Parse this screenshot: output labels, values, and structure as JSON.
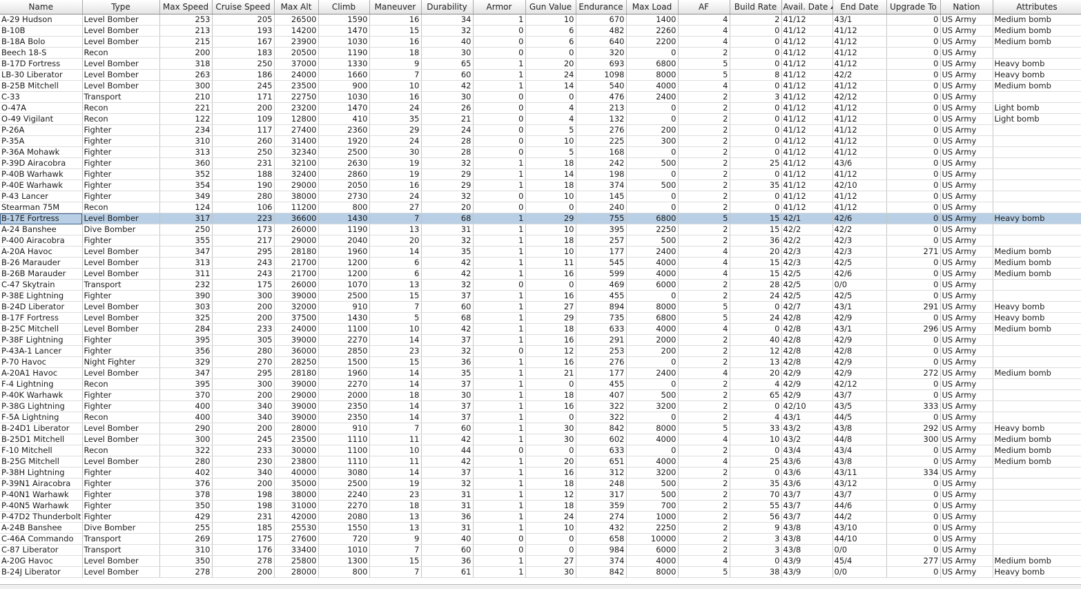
{
  "columns": [
    {
      "key": "name",
      "label": "Name",
      "align": "txt"
    },
    {
      "key": "type",
      "label": "Type",
      "align": "txt"
    },
    {
      "key": "max_speed",
      "label": "Max Speed",
      "align": "num"
    },
    {
      "key": "cruise_speed",
      "label": "Cruise Speed",
      "align": "num"
    },
    {
      "key": "max_alt",
      "label": "Max Alt",
      "align": "num"
    },
    {
      "key": "climb",
      "label": "Climb",
      "align": "num"
    },
    {
      "key": "maneuver",
      "label": "Maneuver",
      "align": "num"
    },
    {
      "key": "durability",
      "label": "Durability",
      "align": "num"
    },
    {
      "key": "armor",
      "label": "Armor",
      "align": "num"
    },
    {
      "key": "gun_value",
      "label": "Gun Value",
      "align": "num"
    },
    {
      "key": "endurance",
      "label": "Endurance",
      "align": "num"
    },
    {
      "key": "max_load",
      "label": "Max Load",
      "align": "num"
    },
    {
      "key": "af",
      "label": "AF",
      "align": "num"
    },
    {
      "key": "build_rate",
      "label": "Build Rate",
      "align": "num"
    },
    {
      "key": "avail_date",
      "label": "Avail. Date",
      "align": "txt",
      "sorted": "asc"
    },
    {
      "key": "end_date",
      "label": "End Date",
      "align": "txt"
    },
    {
      "key": "upgrade_to",
      "label": "Upgrade To",
      "align": "num"
    },
    {
      "key": "nation",
      "label": "Nation",
      "align": "txt"
    },
    {
      "key": "attributes",
      "label": "Attributes",
      "align": "txt"
    }
  ],
  "selected_row": 18,
  "rows": [
    [
      "A-29 Hudson",
      "Level Bomber",
      "253",
      "205",
      "26500",
      "1590",
      "16",
      "34",
      "1",
      "10",
      "670",
      "1400",
      "4",
      "2",
      "41/12",
      "43/1",
      "0",
      "US Army",
      "Medium bomb"
    ],
    [
      "B-10B",
      "Level Bomber",
      "213",
      "193",
      "14200",
      "1470",
      "15",
      "32",
      "0",
      "6",
      "482",
      "2260",
      "4",
      "0",
      "41/12",
      "41/12",
      "0",
      "US Army",
      "Medium bomb"
    ],
    [
      "B-18A Bolo",
      "Level Bomber",
      "215",
      "167",
      "23900",
      "1030",
      "16",
      "40",
      "0",
      "6",
      "640",
      "2200",
      "4",
      "0",
      "41/12",
      "41/12",
      "0",
      "US Army",
      "Medium bomb"
    ],
    [
      "Beech 18-S",
      "Recon",
      "200",
      "183",
      "20500",
      "1190",
      "18",
      "30",
      "0",
      "0",
      "320",
      "0",
      "2",
      "0",
      "41/12",
      "41/12",
      "0",
      "US Army",
      ""
    ],
    [
      "B-17D Fortress",
      "Level Bomber",
      "318",
      "250",
      "37000",
      "1330",
      "9",
      "65",
      "1",
      "20",
      "693",
      "6800",
      "5",
      "0",
      "41/12",
      "41/12",
      "0",
      "US Army",
      "Heavy bomb"
    ],
    [
      "LB-30 Liberator",
      "Level Bomber",
      "263",
      "186",
      "24000",
      "1660",
      "7",
      "60",
      "1",
      "24",
      "1098",
      "8000",
      "5",
      "8",
      "41/12",
      "42/2",
      "0",
      "US Army",
      "Heavy bomb"
    ],
    [
      "B-25B Mitchell",
      "Level Bomber",
      "300",
      "245",
      "23500",
      "900",
      "10",
      "42",
      "1",
      "14",
      "540",
      "4000",
      "4",
      "0",
      "41/12",
      "41/12",
      "0",
      "US Army",
      "Medium bomb"
    ],
    [
      "C-33",
      "Transport",
      "210",
      "171",
      "22750",
      "1030",
      "16",
      "30",
      "0",
      "0",
      "476",
      "2400",
      "2",
      "3",
      "41/12",
      "42/12",
      "0",
      "US Army",
      ""
    ],
    [
      "O-47A",
      "Recon",
      "221",
      "200",
      "23200",
      "1470",
      "24",
      "26",
      "0",
      "4",
      "213",
      "0",
      "2",
      "0",
      "41/12",
      "41/12",
      "0",
      "US Army",
      "Light bomb"
    ],
    [
      "O-49 Vigilant",
      "Recon",
      "122",
      "109",
      "12800",
      "410",
      "35",
      "21",
      "0",
      "4",
      "132",
      "0",
      "2",
      "0",
      "41/12",
      "41/12",
      "0",
      "US Army",
      "Light bomb"
    ],
    [
      "P-26A",
      "Fighter",
      "234",
      "117",
      "27400",
      "2360",
      "29",
      "24",
      "0",
      "5",
      "276",
      "200",
      "2",
      "0",
      "41/12",
      "41/12",
      "0",
      "US Army",
      ""
    ],
    [
      "P-35A",
      "Fighter",
      "310",
      "260",
      "31400",
      "1920",
      "24",
      "28",
      "0",
      "10",
      "225",
      "300",
      "2",
      "0",
      "41/12",
      "41/12",
      "0",
      "US Army",
      ""
    ],
    [
      "P-36A Mohawk",
      "Fighter",
      "313",
      "250",
      "32340",
      "2500",
      "30",
      "28",
      "0",
      "5",
      "168",
      "0",
      "2",
      "0",
      "41/12",
      "41/12",
      "0",
      "US Army",
      ""
    ],
    [
      "P-39D Airacobra",
      "Fighter",
      "360",
      "231",
      "32100",
      "2630",
      "19",
      "32",
      "1",
      "18",
      "242",
      "500",
      "2",
      "25",
      "41/12",
      "43/6",
      "0",
      "US Army",
      ""
    ],
    [
      "P-40B Warhawk",
      "Fighter",
      "352",
      "188",
      "32400",
      "2860",
      "19",
      "29",
      "1",
      "14",
      "198",
      "0",
      "2",
      "0",
      "41/12",
      "41/12",
      "0",
      "US Army",
      ""
    ],
    [
      "P-40E Warhawk",
      "Fighter",
      "354",
      "190",
      "29000",
      "2050",
      "16",
      "29",
      "1",
      "18",
      "374",
      "500",
      "2",
      "35",
      "41/12",
      "42/10",
      "0",
      "US Army",
      ""
    ],
    [
      "P-43 Lancer",
      "Fighter",
      "349",
      "280",
      "38000",
      "2730",
      "24",
      "32",
      "0",
      "10",
      "145",
      "0",
      "2",
      "0",
      "41/12",
      "41/12",
      "0",
      "US Army",
      ""
    ],
    [
      "Stearman 75M",
      "Recon",
      "124",
      "106",
      "11200",
      "800",
      "27",
      "20",
      "0",
      "0",
      "240",
      "0",
      "2",
      "0",
      "41/12",
      "41/12",
      "0",
      "US Army",
      ""
    ],
    [
      "B-17E Fortress",
      "Level Bomber",
      "317",
      "223",
      "36600",
      "1430",
      "7",
      "68",
      "1",
      "29",
      "755",
      "6800",
      "5",
      "15",
      "42/1",
      "42/6",
      "0",
      "US Army",
      "Heavy bomb"
    ],
    [
      "A-24 Banshee",
      "Dive Bomber",
      "250",
      "173",
      "26000",
      "1190",
      "13",
      "31",
      "1",
      "10",
      "395",
      "2250",
      "2",
      "15",
      "42/2",
      "42/2",
      "0",
      "US Army",
      ""
    ],
    [
      "P-400 Airacobra",
      "Fighter",
      "355",
      "217",
      "29000",
      "2040",
      "20",
      "32",
      "1",
      "18",
      "257",
      "500",
      "2",
      "36",
      "42/2",
      "42/3",
      "0",
      "US Army",
      ""
    ],
    [
      "A-20A Havoc",
      "Level Bomber",
      "347",
      "295",
      "28180",
      "1960",
      "14",
      "35",
      "1",
      "10",
      "177",
      "2400",
      "4",
      "20",
      "42/3",
      "42/3",
      "271",
      "US Army",
      "Medium bomb"
    ],
    [
      "B-26 Marauder",
      "Level Bomber",
      "313",
      "243",
      "21700",
      "1200",
      "6",
      "42",
      "1",
      "11",
      "545",
      "4000",
      "4",
      "15",
      "42/3",
      "42/5",
      "0",
      "US Army",
      "Medium bomb"
    ],
    [
      "B-26B Marauder",
      "Level Bomber",
      "311",
      "243",
      "21700",
      "1200",
      "6",
      "42",
      "1",
      "16",
      "599",
      "4000",
      "4",
      "15",
      "42/5",
      "42/6",
      "0",
      "US Army",
      "Medium bomb"
    ],
    [
      "C-47 Skytrain",
      "Transport",
      "232",
      "175",
      "26000",
      "1070",
      "13",
      "32",
      "0",
      "0",
      "469",
      "6000",
      "2",
      "28",
      "42/5",
      "0/0",
      "0",
      "US Army",
      ""
    ],
    [
      "P-38E Lightning",
      "Fighter",
      "390",
      "300",
      "39000",
      "2500",
      "15",
      "37",
      "1",
      "16",
      "455",
      "0",
      "2",
      "24",
      "42/5",
      "42/5",
      "0",
      "US Army",
      ""
    ],
    [
      "B-24D Liberator",
      "Level Bomber",
      "303",
      "200",
      "32000",
      "910",
      "7",
      "60",
      "1",
      "27",
      "894",
      "8000",
      "5",
      "0",
      "42/7",
      "43/1",
      "291",
      "US Army",
      "Heavy bomb"
    ],
    [
      "B-17F Fortress",
      "Level Bomber",
      "325",
      "200",
      "37500",
      "1430",
      "5",
      "68",
      "1",
      "29",
      "735",
      "6800",
      "5",
      "24",
      "42/8",
      "42/9",
      "0",
      "US Army",
      "Heavy bomb"
    ],
    [
      "B-25C Mitchell",
      "Level Bomber",
      "284",
      "233",
      "24000",
      "1100",
      "10",
      "42",
      "1",
      "18",
      "633",
      "4000",
      "4",
      "0",
      "42/8",
      "43/1",
      "296",
      "US Army",
      "Medium bomb"
    ],
    [
      "P-38F Lightning",
      "Fighter",
      "395",
      "305",
      "39000",
      "2270",
      "14",
      "37",
      "1",
      "16",
      "291",
      "2000",
      "2",
      "40",
      "42/8",
      "42/9",
      "0",
      "US Army",
      ""
    ],
    [
      "P-43A-1 Lancer",
      "Fighter",
      "356",
      "280",
      "36000",
      "2850",
      "23",
      "32",
      "0",
      "12",
      "253",
      "200",
      "2",
      "12",
      "42/8",
      "42/8",
      "0",
      "US Army",
      ""
    ],
    [
      "P-70 Havoc",
      "Night Fighter",
      "329",
      "270",
      "28250",
      "1500",
      "15",
      "36",
      "1",
      "16",
      "276",
      "0",
      "2",
      "13",
      "42/8",
      "42/9",
      "0",
      "US Army",
      ""
    ],
    [
      "A-20A1 Havoc",
      "Level Bomber",
      "347",
      "295",
      "28180",
      "1960",
      "14",
      "35",
      "1",
      "21",
      "177",
      "2400",
      "4",
      "20",
      "42/9",
      "42/9",
      "272",
      "US Army",
      "Medium bomb"
    ],
    [
      "F-4 Lightning",
      "Recon",
      "395",
      "300",
      "39000",
      "2270",
      "14",
      "37",
      "1",
      "0",
      "455",
      "0",
      "2",
      "4",
      "42/9",
      "42/12",
      "0",
      "US Army",
      ""
    ],
    [
      "P-40K Warhawk",
      "Fighter",
      "370",
      "200",
      "29000",
      "2000",
      "18",
      "30",
      "1",
      "18",
      "407",
      "500",
      "2",
      "65",
      "42/9",
      "43/7",
      "0",
      "US Army",
      ""
    ],
    [
      "P-38G Lightning",
      "Fighter",
      "400",
      "340",
      "39000",
      "2350",
      "14",
      "37",
      "1",
      "16",
      "322",
      "3200",
      "2",
      "0",
      "42/10",
      "43/5",
      "333",
      "US Army",
      ""
    ],
    [
      "F-5A Lightning",
      "Recon",
      "400",
      "340",
      "39000",
      "2350",
      "14",
      "37",
      "1",
      "0",
      "322",
      "0",
      "2",
      "4",
      "43/1",
      "44/5",
      "0",
      "US Army",
      ""
    ],
    [
      "B-24D1 Liberator",
      "Level Bomber",
      "290",
      "200",
      "28000",
      "910",
      "7",
      "60",
      "1",
      "30",
      "842",
      "8000",
      "5",
      "33",
      "43/2",
      "43/8",
      "292",
      "US Army",
      "Heavy bomb"
    ],
    [
      "B-25D1 Mitchell",
      "Level Bomber",
      "300",
      "245",
      "23500",
      "1110",
      "11",
      "42",
      "1",
      "30",
      "602",
      "4000",
      "4",
      "10",
      "43/2",
      "44/8",
      "300",
      "US Army",
      "Medium bomb"
    ],
    [
      "F-10 Mitchell",
      "Recon",
      "322",
      "233",
      "30000",
      "1100",
      "10",
      "44",
      "0",
      "0",
      "633",
      "0",
      "2",
      "0",
      "43/4",
      "43/4",
      "0",
      "US Army",
      "Medium bomb"
    ],
    [
      "B-25G Mitchell",
      "Level Bomber",
      "280",
      "230",
      "23800",
      "1110",
      "11",
      "42",
      "1",
      "20",
      "651",
      "4000",
      "4",
      "25",
      "43/6",
      "43/8",
      "0",
      "US Army",
      "Medium bomb"
    ],
    [
      "P-38H Lightning",
      "Fighter",
      "402",
      "340",
      "40000",
      "3080",
      "14",
      "37",
      "1",
      "16",
      "312",
      "3200",
      "2",
      "0",
      "43/6",
      "43/11",
      "334",
      "US Army",
      ""
    ],
    [
      "P-39N1 Airacobra",
      "Fighter",
      "376",
      "200",
      "35000",
      "2500",
      "19",
      "32",
      "1",
      "18",
      "248",
      "500",
      "2",
      "35",
      "43/6",
      "43/12",
      "0",
      "US Army",
      ""
    ],
    [
      "P-40N1 Warhawk",
      "Fighter",
      "378",
      "198",
      "38000",
      "2240",
      "23",
      "31",
      "1",
      "12",
      "317",
      "500",
      "2",
      "70",
      "43/7",
      "43/7",
      "0",
      "US Army",
      ""
    ],
    [
      "P-40N5 Warhawk",
      "Fighter",
      "350",
      "198",
      "31000",
      "2270",
      "18",
      "31",
      "1",
      "18",
      "359",
      "700",
      "2",
      "55",
      "43/7",
      "44/6",
      "0",
      "US Army",
      ""
    ],
    [
      "P-47D2 Thunderbolt",
      "Fighter",
      "429",
      "231",
      "42000",
      "2080",
      "13",
      "36",
      "1",
      "24",
      "274",
      "1000",
      "2",
      "56",
      "43/7",
      "44/2",
      "0",
      "US Army",
      ""
    ],
    [
      "A-24B Banshee",
      "Dive Bomber",
      "255",
      "185",
      "25530",
      "1550",
      "13",
      "31",
      "1",
      "10",
      "432",
      "2250",
      "2",
      "9",
      "43/8",
      "43/10",
      "0",
      "US Army",
      ""
    ],
    [
      "C-46A Commando",
      "Transport",
      "269",
      "175",
      "27600",
      "720",
      "9",
      "40",
      "0",
      "0",
      "658",
      "10000",
      "2",
      "3",
      "43/8",
      "44/10",
      "0",
      "US Army",
      ""
    ],
    [
      "C-87 Liberator",
      "Transport",
      "310",
      "176",
      "33400",
      "1010",
      "7",
      "60",
      "0",
      "0",
      "984",
      "6000",
      "2",
      "3",
      "43/8",
      "0/0",
      "0",
      "US Army",
      ""
    ],
    [
      "A-20G Havoc",
      "Level Bomber",
      "350",
      "278",
      "25800",
      "1300",
      "15",
      "36",
      "1",
      "27",
      "374",
      "4000",
      "4",
      "0",
      "43/9",
      "45/4",
      "277",
      "US Army",
      "Medium bomb"
    ],
    [
      "B-24J Liberator",
      "Level Bomber",
      "278",
      "200",
      "28000",
      "800",
      "7",
      "61",
      "1",
      "30",
      "842",
      "8000",
      "5",
      "38",
      "43/9",
      "0/0",
      "0",
      "US Army",
      "Heavy bomb"
    ]
  ]
}
